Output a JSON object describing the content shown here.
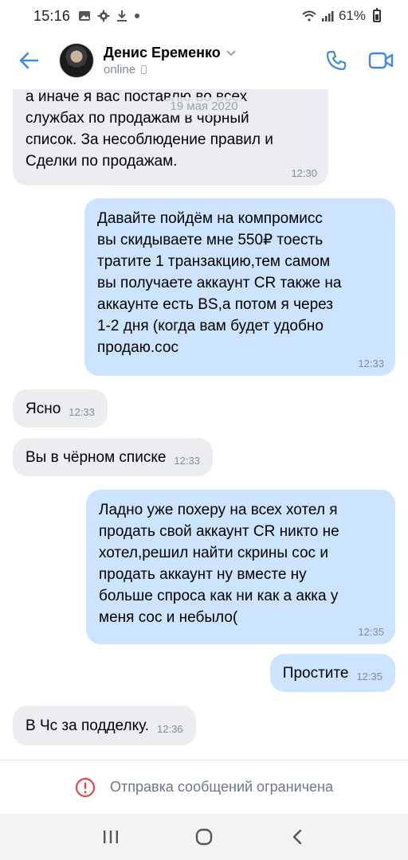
{
  "status_bar": {
    "time": "15:16",
    "battery": "61%",
    "icons": [
      "image-icon",
      "gear-icon",
      "download-icon",
      "dot-icon",
      "wifi-icon",
      "signal-icon",
      "battery-icon"
    ]
  },
  "header": {
    "contact_name": "Денис Еременко",
    "contact_status": "online",
    "icons": [
      "back-arrow-icon",
      "chevron-down-icon",
      "phone-icon",
      "video-icon"
    ],
    "accent_color": "#3f8ae0"
  },
  "chat": {
    "date": "19 мая 2020",
    "messages": [
      {
        "dir": "in",
        "lines": [
          "а иначе я вас поставлю во всех",
          "службах по продажам в чорный",
          "список. За несоблюдение правил и",
          "Сделки по продажам."
        ],
        "time": "12:30"
      },
      {
        "dir": "out",
        "lines": [
          "Давайте пойдём на компромисс",
          "вы скидываете мне 550₽ тоесть",
          "тратите 1 транзакцию,тем самом",
          "вы получаете аккаунт CR также на",
          "аккаунте есть BS,а потом я через",
          "1-2 дня (когда вам будет удобно",
          "продаю.сос"
        ],
        "time": "12:33"
      },
      {
        "dir": "in",
        "text": "Ясно",
        "time": "12:33"
      },
      {
        "dir": "in",
        "text": "Вы в чёрном списке",
        "time": "12:33"
      },
      {
        "dir": "out",
        "lines": [
          "Ладно уже похеру на всех хотел я",
          "продать свой аккаунт CR никто не",
          "хотел,решил найти скрины сос и",
          "продать аккаунт ну вместе ну",
          "больше спроса как ни как а акка у",
          "меня сос и небыло("
        ],
        "time": "12:35"
      },
      {
        "dir": "out",
        "text": "Простите",
        "time": "12:35"
      },
      {
        "dir": "in",
        "text": "В Чс за подделку.",
        "time": "12:36"
      }
    ],
    "colors": {
      "incoming": "#ebedf0",
      "outgoing": "#cce4ff"
    }
  },
  "footer": {
    "restricted_text": "Отправка сообщений ограничена",
    "warning_color": "#e64646"
  },
  "navbar": {
    "icons": [
      "recent-apps-icon",
      "home-icon",
      "back-icon"
    ]
  }
}
